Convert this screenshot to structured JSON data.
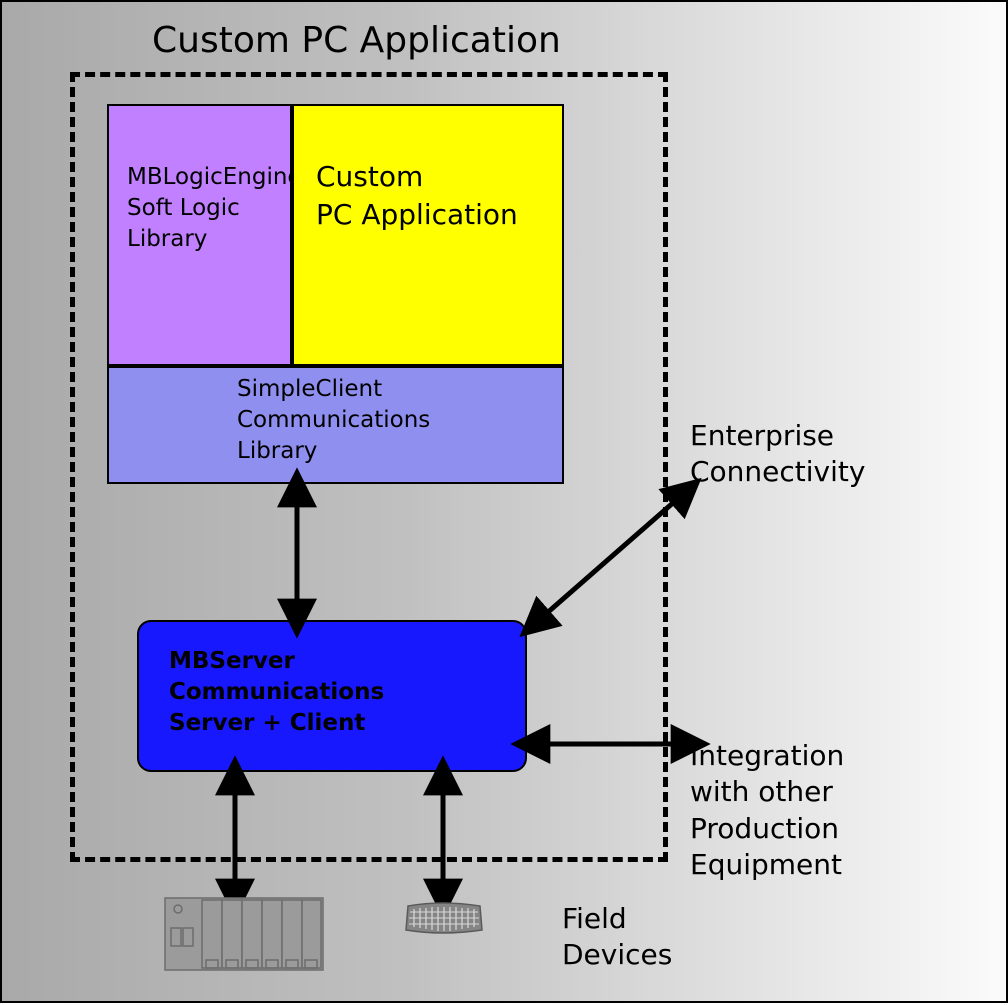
{
  "title": "Custom PC Application",
  "boxes": {
    "mblogic": "MBLogicEngine\nSoft Logic\nLibrary",
    "custom_app": "Custom\nPC Application",
    "simpleclient": "SimpleClient\nCommunications\nLibrary",
    "mbserver": "MBServer\nCommunications\nServer + Client"
  },
  "labels": {
    "enterprise": "Enterprise\nConnectivity",
    "integration": "Integration\nwith other\nProduction\nEquipment",
    "field": "Field\nDevices"
  },
  "colors": {
    "purple": "#c080ff",
    "yellow": "#ffff00",
    "indigo": "#8f8ff0",
    "blue": "#1818ff"
  }
}
